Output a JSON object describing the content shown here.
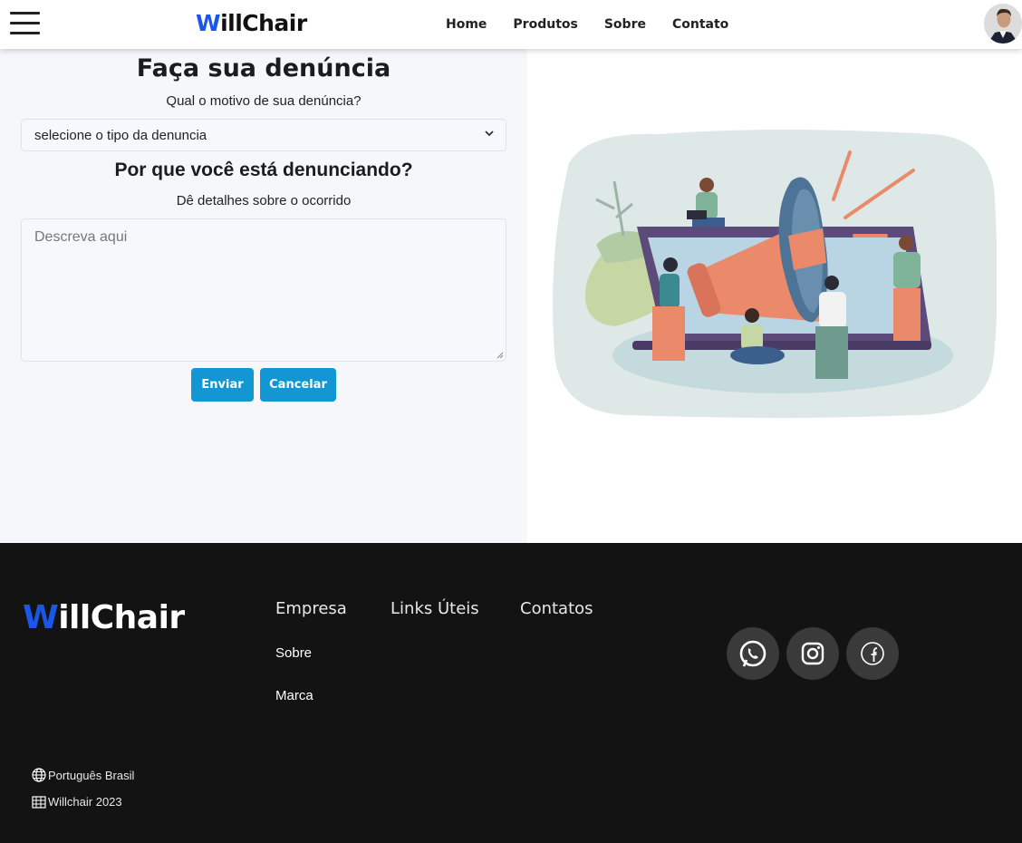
{
  "header": {
    "brand_first": "W",
    "brand_rest": "illChair",
    "nav": [
      "Home",
      "Produtos",
      "Sobre",
      "Contato"
    ]
  },
  "form": {
    "title": "Faça sua denúncia",
    "reason_label": "Qual o motivo de sua denúncia?",
    "select_value": "selecione o tipo da denuncia",
    "why_title": "Por que você está denunciando?",
    "details_label": "Dê detalhes sobre o ocorrido",
    "textarea_placeholder": "Descreva aqui",
    "send_label": "Enviar",
    "cancel_label": "Cancelar"
  },
  "footer": {
    "brand_first": "W",
    "brand_rest": "illChair",
    "columns": [
      "Empresa",
      "Links Úteis",
      "Contatos"
    ],
    "empresa_links": [
      "Sobre",
      "Marca"
    ],
    "social": [
      "whatsapp-icon",
      "instagram-icon",
      "facebook-icon"
    ],
    "language": "Português Brasil",
    "copyright": "Willchair 2023"
  },
  "colors": {
    "brand_blue": "#1a56e8",
    "button": "#1297d4",
    "footer_bg": "#131313",
    "panel_bg": "#f5f7fb"
  }
}
